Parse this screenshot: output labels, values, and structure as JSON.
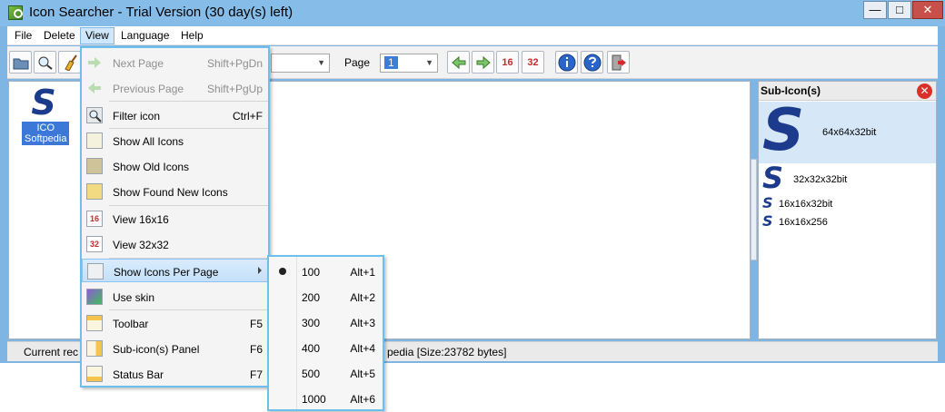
{
  "window": {
    "title": "Icon Searcher - Trial Version (30 day(s) left)",
    "minimize": "—",
    "maximize": "□",
    "close": "✕"
  },
  "menubar": {
    "items": [
      "File",
      "Delete",
      "View",
      "Language",
      "Help"
    ],
    "active": "View"
  },
  "toolbar": {
    "page_label": "Page",
    "page_value": "1",
    "view16_label": "16",
    "view32_label": "32"
  },
  "main": {
    "icon_caption_line1": "ICO",
    "icon_caption_line2": "Softpedia",
    "icon_glyph": "S"
  },
  "subpane": {
    "header": "Sub-Icon(s)",
    "close_glyph": "✕",
    "rows": [
      {
        "label": "64x64x32bit",
        "glyph": "S"
      },
      {
        "label": "32x32x32bit",
        "glyph": "S"
      },
      {
        "label": "16x16x32bit",
        "glyph": "S"
      },
      {
        "label": "16x16x256",
        "glyph": "S"
      }
    ]
  },
  "statusbar": {
    "left": "Current rec",
    "right": "pedia [Size:23782 bytes]"
  },
  "view_menu": {
    "items": [
      {
        "label": "Next Page",
        "shortcut": "Shift+PgDn"
      },
      {
        "label": "Previous Page",
        "shortcut": "Shift+PgUp"
      },
      {
        "label": "Filter icon",
        "shortcut": "Ctrl+F"
      },
      {
        "label": "Show All Icons",
        "shortcut": ""
      },
      {
        "label": "Show Old Icons",
        "shortcut": ""
      },
      {
        "label": "Show Found New Icons",
        "shortcut": ""
      },
      {
        "label": "View 16x16",
        "shortcut": "",
        "icon_text": "16"
      },
      {
        "label": "View 32x32",
        "shortcut": "",
        "icon_text": "32"
      },
      {
        "label": "Show Icons Per Page",
        "shortcut": ""
      },
      {
        "label": "Use skin",
        "shortcut": ""
      },
      {
        "label": "Toolbar",
        "shortcut": "F5"
      },
      {
        "label": "Sub-icon(s) Panel",
        "shortcut": "F6"
      },
      {
        "label": "Status Bar",
        "shortcut": "F7"
      }
    ]
  },
  "per_page_submenu": {
    "selected": "100",
    "items": [
      {
        "label": "100",
        "shortcut": "Alt+1"
      },
      {
        "label": "200",
        "shortcut": "Alt+2"
      },
      {
        "label": "300",
        "shortcut": "Alt+3"
      },
      {
        "label": "400",
        "shortcut": "Alt+4"
      },
      {
        "label": "500",
        "shortcut": "Alt+5"
      },
      {
        "label": "1000",
        "shortcut": "Alt+6"
      }
    ]
  },
  "colors": {
    "title_bar": "#86bce8",
    "menu_border": "#6ec0ec",
    "selection": "#3b78d8",
    "brand_s": "#1c3b8c"
  }
}
